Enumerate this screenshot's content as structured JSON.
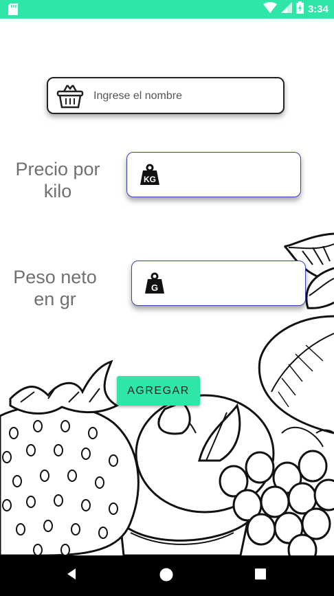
{
  "theme": {
    "accent": "#2ee6a8",
    "field_border": "#3b3fb3",
    "label_color": "#707070"
  },
  "status_bar": {
    "time": "3:34",
    "icons": [
      "sd-card-icon",
      "wifi-icon",
      "signal-icon",
      "battery-icon"
    ]
  },
  "form": {
    "name": {
      "placeholder": "Ingrese el nombre",
      "value": "",
      "icon": "basket-icon"
    },
    "price": {
      "label": "Precio por kilo",
      "value": "",
      "icon": "kg-weight-icon"
    },
    "weight": {
      "label": "Peso neto en gr",
      "value": "",
      "icon": "g-weight-icon"
    },
    "submit_label": "AGREGAR"
  },
  "nav_bar": {
    "items": [
      "back-icon",
      "home-icon",
      "recents-icon"
    ]
  }
}
